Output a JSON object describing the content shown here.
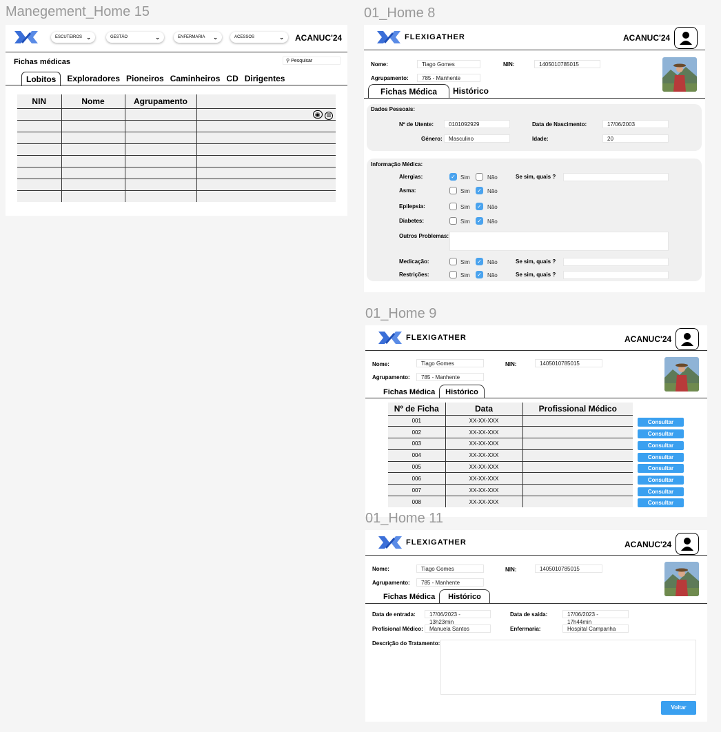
{
  "mgmt": {
    "frame_label": "Manegement_Home 15",
    "menus": [
      "ESCUTEIROS",
      "GESTÃO",
      "ENFERMARIA",
      "ACESSOS"
    ],
    "brand": "ACANUC'24",
    "page_title": "Fichas médicas",
    "search_placeholder": "Pesquisar",
    "tabs": [
      "Lobitos",
      "Exploradores",
      "Pioneiros",
      "Caminheiros",
      "CD",
      "Dirigentes"
    ],
    "columns": [
      "NIN",
      "Nome",
      "Agrupamento"
    ]
  },
  "ficha": {
    "frame_label": "01_Home 8",
    "logo_text": "FLEXIGATHER",
    "brand": "ACANUC'24",
    "nome_label": "Nome:",
    "nome": "Tiago Gomes",
    "nin_label": "NIN:",
    "nin": "1405010785015",
    "agrupamento_label": "Agrupamento:",
    "agrupamento": "785 - Manhente",
    "tab_ficha": "Fichas Médica",
    "tab_historico": "Histórico",
    "dados_title": "Dados Pessoais:",
    "utente_label": "Nº de Utente:",
    "utente": "0101092929",
    "nasc_label": "Data de Nascimento:",
    "nasc": "17/06/2003",
    "genero_label": "Género:",
    "genero": "Masculino",
    "idade_label": "Idade:",
    "idade": "20",
    "info_title": "Informação Médica:",
    "alergias": "Alergias:",
    "asma": "Asma:",
    "epilepsia": "Epilepsia:",
    "diabetes": "Diabetes:",
    "outros": "Outros Problemas:",
    "medicacao": "Medicação:",
    "restricoes": "Restrições:",
    "sim": "Sim",
    "nao": "Não",
    "se_sim": "Se sim, quais ?"
  },
  "hist": {
    "frame_label": "01_Home 9",
    "columns": [
      "Nº de Ficha",
      "Data",
      "Profissional Médico"
    ],
    "rows": [
      {
        "n": "001",
        "d": "XX-XX-XXX"
      },
      {
        "n": "002",
        "d": "XX-XX-XXX"
      },
      {
        "n": "003",
        "d": "XX-XX-XXX"
      },
      {
        "n": "004",
        "d": "XX-XX-XXX"
      },
      {
        "n": "005",
        "d": "XX-XX-XXX"
      },
      {
        "n": "006",
        "d": "XX-XX-XXX"
      },
      {
        "n": "007",
        "d": "XX-XX-XXX"
      },
      {
        "n": "008",
        "d": "XX-XX-XXX"
      }
    ],
    "consultar": "Consultar"
  },
  "detail": {
    "frame_label": "01_Home 11",
    "entrada_label": "Data de entrada:",
    "entrada": "17/06/2023 - 13h23min",
    "saida_label": "Data de saída:",
    "saida": "17/06/2023 - 17h44min",
    "prof_label": "Profisional Médico:",
    "prof": "Manuela Santos",
    "enf_label": "Enfermaria:",
    "enf": "Hospital Campanha",
    "desc_label": "Descrição do Tratamento:",
    "voltar": "Voltar"
  },
  "colors": {
    "accent_blue": "#3aa0f0",
    "logo_blue": "#3b6fd8",
    "panel_gray": "#f0f0f0"
  }
}
